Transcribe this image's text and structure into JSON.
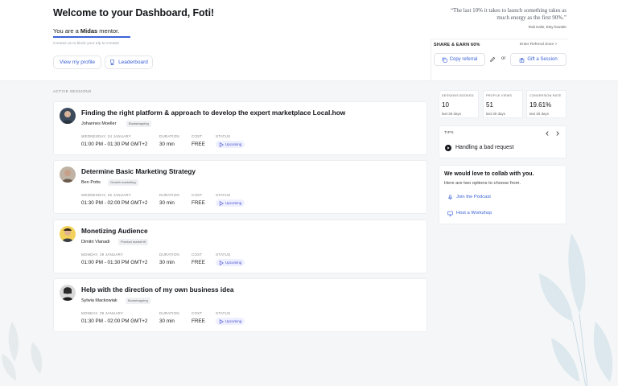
{
  "header": {
    "title": "Welcome to your Dashboard, Foti!",
    "mentor_prefix": "You are a ",
    "mentor_level": "Midas",
    "mentor_suffix": " mentor.",
    "level_progress": 1.0,
    "contact_note": "Contact us to block your trip to Creator",
    "view_profile": "View my profile",
    "leaderboard": "Leaderboard"
  },
  "quote": {
    "text": "“The last 10% it takes to launch something takes as much energy as the first 90%.”",
    "author": "Rob Kalin, Etsy founder"
  },
  "share": {
    "title": "SHARE & EARN 60%",
    "referral_zone": "Enter Referral Zone >",
    "copy_referral": "Copy referral",
    "or": "or",
    "gift_session": "Gift a Session"
  },
  "active_sessions_label": "ACTIVE SESSIONS",
  "labels": {
    "duration": "DURATION",
    "cost": "COST",
    "status": "STATUS"
  },
  "sessions": [
    {
      "title": "Finding the right platform & approach to develop the expert marketplace Local.how",
      "mentor": "Johannes Moeller",
      "tag": "Bootstrapping",
      "date": "WEDNESDAY, 24 JANUARY",
      "time": "01:00 PM - 01:30 PM GMT+2",
      "duration": "30 min",
      "cost": "FREE",
      "status": "Upcoming"
    },
    {
      "title": "Determine Basic Marketing Strategy",
      "mentor": "Ben Potts",
      "tag": "Growth marketing",
      "date": "WEDNESDAY, 25 JANUARY",
      "time": "01:30 PM - 02:00 PM GMT+2",
      "duration": "30 min",
      "cost": "FREE",
      "status": "Upcoming"
    },
    {
      "title": "Monetizing Audience",
      "mentor": "Dimitri Vlanadi",
      "tag": "Product market fit",
      "date": "MONDAY, 29 JANUARY",
      "time": "01:00 PM - 01:30 PM GMT+2",
      "duration": "30 min",
      "cost": "FREE",
      "status": "Upcoming"
    },
    {
      "title": "Help with the direction of my own business idea",
      "mentor": "Sylwia Mackowiak",
      "tag": "Bootstrapping",
      "date": "MONDAY, 29 JANUARY",
      "time": "01:30 PM - 02:00 PM GMT+2",
      "duration": "30 min",
      "cost": "FREE",
      "status": "Upcoming"
    }
  ],
  "stats": [
    {
      "label": "SESSIONS BOOKED",
      "value": "10",
      "sub": "last 30 days"
    },
    {
      "label": "PROFILE VIEWS",
      "value": "51",
      "sub": "last 30 days"
    },
    {
      "label": "CONVERSION RATE",
      "value": "19.61%",
      "sub": "last 30 days"
    }
  ],
  "tips": {
    "label": "TIPS",
    "text": "Handling a bad request"
  },
  "collab": {
    "title": "We would love to collab with you.",
    "subtitle": "Here are two options to choose from.",
    "podcast": "Join the Podcast",
    "workshop": "Host a Workshop"
  },
  "colors": {
    "accent": "#3b62d9",
    "status_bg": "#eef0ff",
    "status_text": "#4a4fd0"
  }
}
